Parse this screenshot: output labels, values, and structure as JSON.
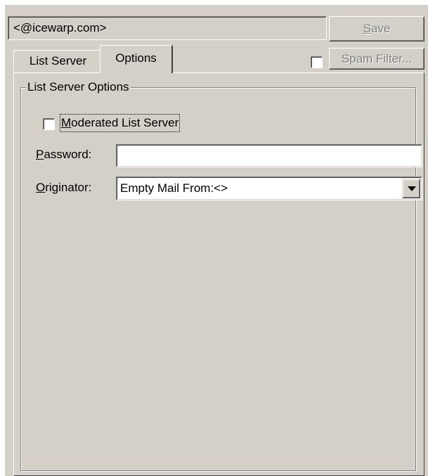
{
  "header": {
    "email_value": "<@icewarp.com>",
    "save_label": "Save",
    "save_accesskey": "S",
    "spam_filter_label": "Spam Filter...",
    "spam_filter_checked": false
  },
  "tabs": [
    {
      "label": "List Server",
      "active": false
    },
    {
      "label": "Options",
      "active": true
    }
  ],
  "options_panel": {
    "group_title": "List Server Options",
    "moderated": {
      "label_first": "M",
      "label_rest": "oderated List Server",
      "checked": false
    },
    "password": {
      "label_first": "P",
      "label_rest": "assword:",
      "value": ""
    },
    "originator": {
      "label_first": "O",
      "label_rest": "riginator:",
      "selected": "Empty Mail From:<>"
    }
  },
  "icons": {
    "dropdown": "chevron-down-icon"
  },
  "colors": {
    "face": "#d4d0c8",
    "shadow": "#808080",
    "highlight": "#ffffff",
    "disabled_text": "#808080"
  }
}
